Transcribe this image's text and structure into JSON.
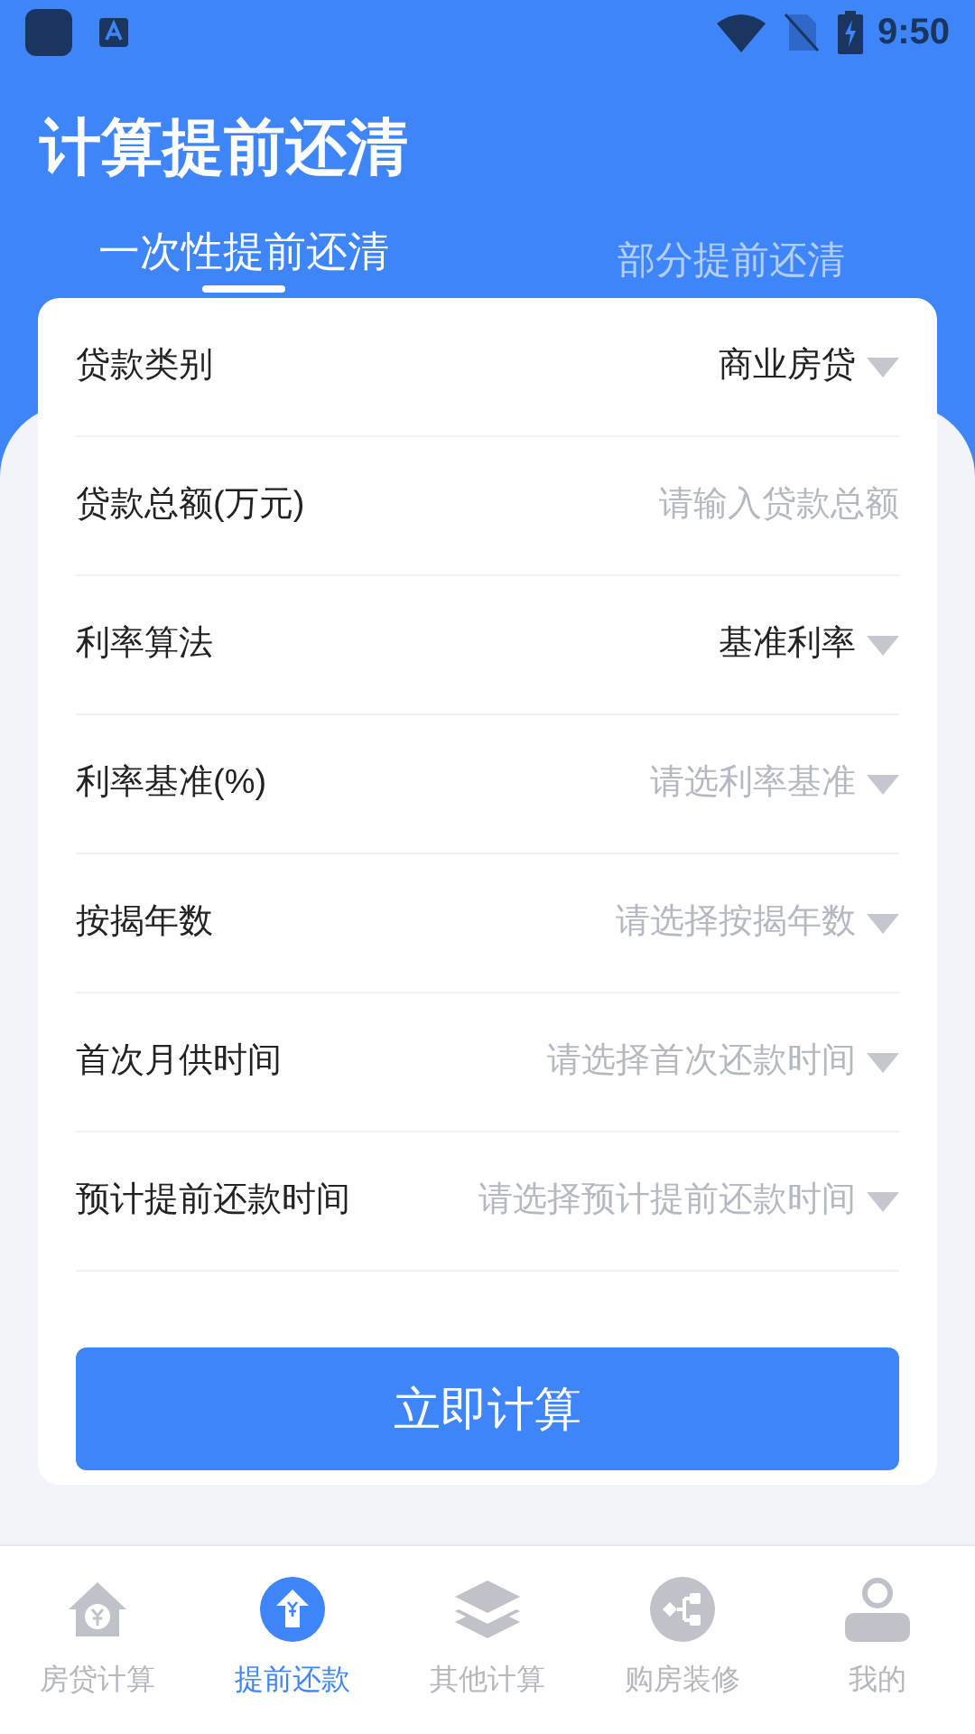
{
  "status_bar": {
    "time": "9:50"
  },
  "title": "计算提前还清",
  "tabs": [
    {
      "label": "一次性提前还清",
      "selected": true
    },
    {
      "label": "部分提前还清",
      "selected": false
    }
  ],
  "form": {
    "fields": [
      {
        "label": "贷款类别",
        "kind": "select",
        "value": "商业房贷"
      },
      {
        "label": "贷款总额(万元)",
        "kind": "input",
        "placeholder": "请输入贷款总额"
      },
      {
        "label": "利率算法",
        "kind": "select",
        "value": "基准利率"
      },
      {
        "label": "利率基准(%)",
        "kind": "select",
        "placeholder": "请选利率基准"
      },
      {
        "label": "按揭年数",
        "kind": "select",
        "placeholder": "请选择按揭年数"
      },
      {
        "label": "首次月供时间",
        "kind": "select",
        "placeholder": "请选择首次还款时间"
      },
      {
        "label": "预计提前还款时间",
        "kind": "select",
        "placeholder": "请选择预计提前还款时间"
      }
    ],
    "submit": "立即计算"
  },
  "nav": [
    {
      "label": "房贷计算",
      "kind": "house",
      "selected": false
    },
    {
      "label": "提前还款",
      "kind": "upload",
      "selected": true
    },
    {
      "label": "其他计算",
      "kind": "layers",
      "selected": false
    },
    {
      "label": "购房装修",
      "kind": "flow",
      "selected": false
    },
    {
      "label": "我的",
      "kind": "user",
      "selected": false
    }
  ]
}
